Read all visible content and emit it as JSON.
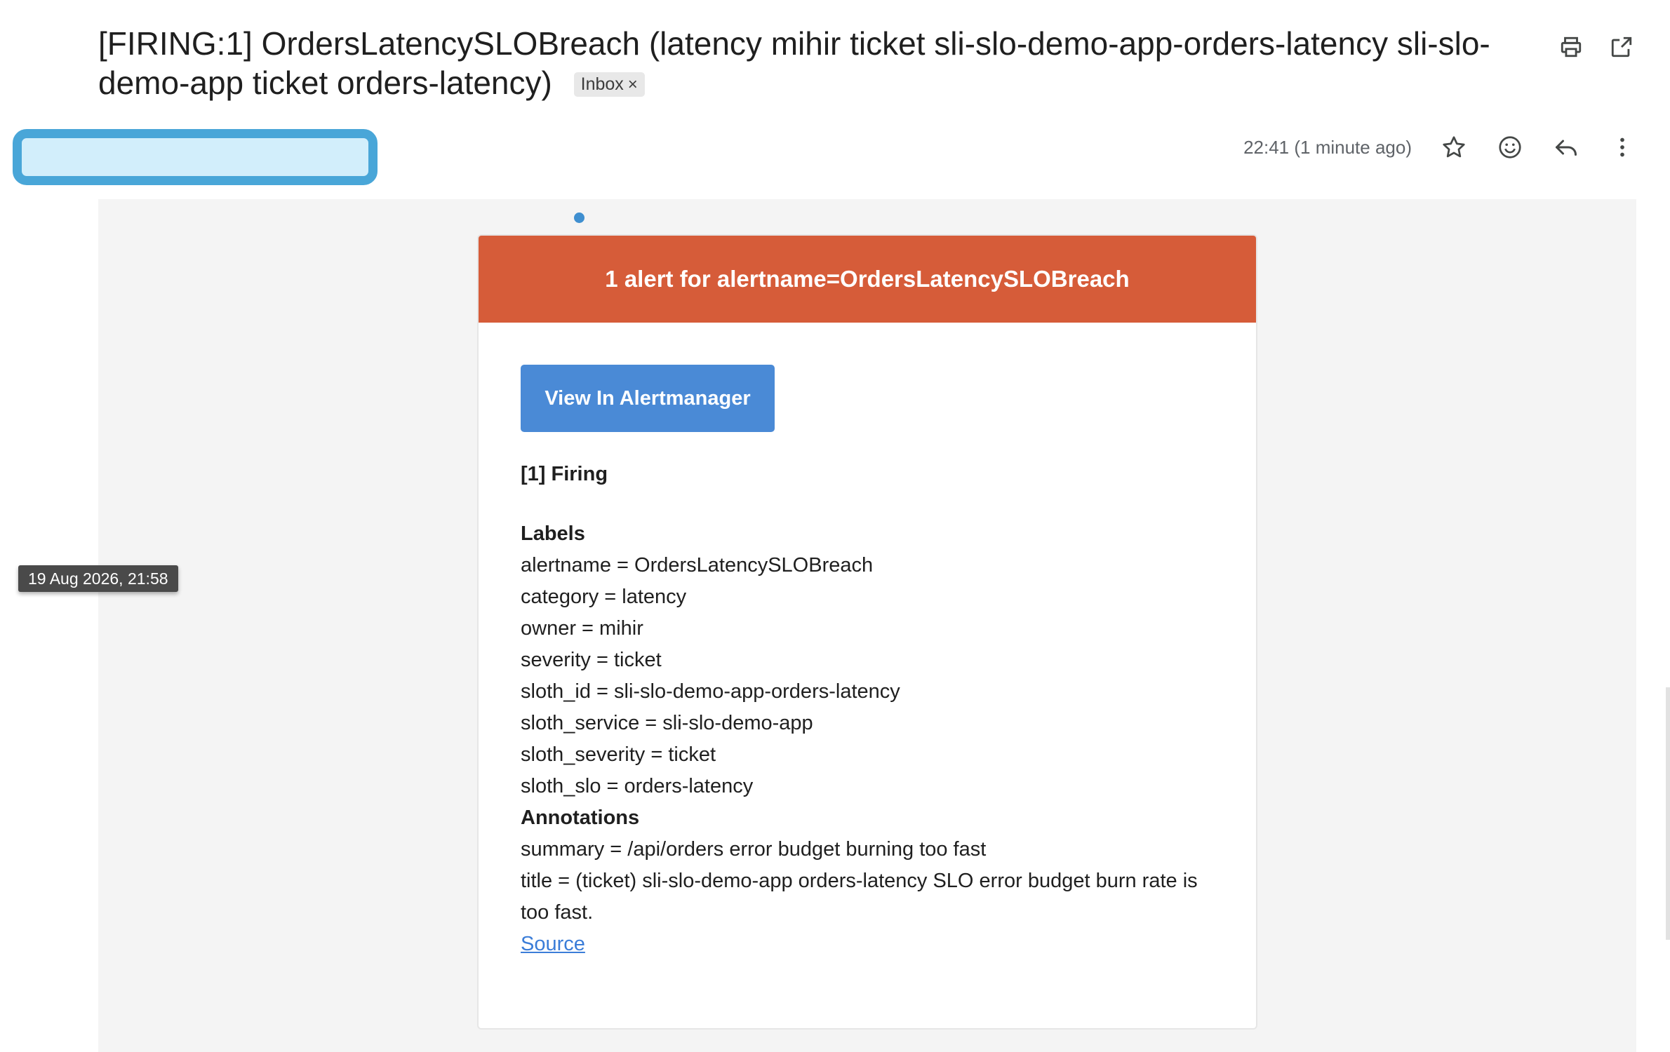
{
  "subject": {
    "title": "[FIRING:1] OrdersLatencySLOBreach (latency mihir ticket sli-slo-demo-app-orders-latency sli-slo-demo-app ticket orders-latency)",
    "inbox_label": "Inbox",
    "inbox_remove": "×"
  },
  "message_meta": {
    "timestamp": "22:41 (1 minute ago)",
    "tooltip": "19 Aug 2026, 21:58"
  },
  "icons": {
    "print": "print-icon",
    "open_new_window": "open-in-new-window-icon",
    "star": "star-icon",
    "emoji": "emoji-reaction-icon",
    "reply": "reply-icon",
    "more": "more-options-icon"
  },
  "alert": {
    "header": "1 alert for alertname=OrdersLatencySLOBreach",
    "button": "View In Alertmanager",
    "firing": "[1] Firing",
    "labels_heading": "Labels",
    "labels": [
      "alertname = OrdersLatencySLOBreach",
      "category = latency",
      "owner = mihir",
      "severity = ticket",
      "sloth_id = sli-slo-demo-app-orders-latency",
      "sloth_service = sli-slo-demo-app",
      "sloth_severity = ticket",
      "sloth_slo = orders-latency"
    ],
    "annotations_heading": "Annotations",
    "annotations": [
      "summary = /api/orders error budget burning too fast",
      "title = (ticket) sli-slo-demo-app orders-latency SLO error budget burn rate is too fast."
    ],
    "source_link": "Source"
  },
  "colors": {
    "alert_header_bg": "#d65c39",
    "button_bg": "#4a8ad6",
    "link": "#3b7dd8",
    "highlight_border": "#49a6d8",
    "highlight_fill": "#d2eefb"
  }
}
